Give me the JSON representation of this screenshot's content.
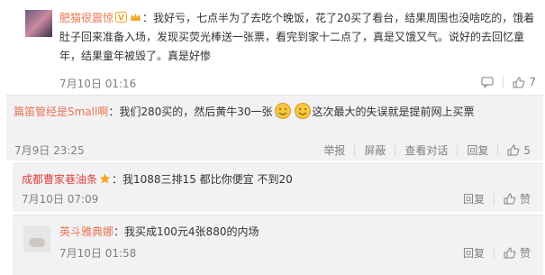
{
  "comments": [
    {
      "name": "肥猫很震惊",
      "text": "：我好亏，七点半为了去吃个晚饭，花了20买了看台，结果周围也没啥吃的，饿着肚子回来准备入场，发现买荧光棒送一张票，看完到家十二点了，真是又饿又气。说好的去回忆童年，结果童年被毁了。真是好惨",
      "time": "7月10日 01:16",
      "like_count": "7"
    },
    {
      "name": "篇笛管经是Small啊",
      "text_before": "：我们280买的，然后黄牛30一张",
      "text_after": "这次最大的失误就是提前网上买票",
      "time": "7月9日 23:25",
      "actions": [
        "举报",
        "屏蔽",
        "查看对话",
        "回复"
      ],
      "like_count": "5"
    },
    {
      "name": "成都曹家巷油条",
      "text": "：我1088三排15 都比你便宜 不到20",
      "time": "7月10日 07:09",
      "actions": [
        "回复",
        "赞"
      ]
    },
    {
      "name": "英斗雅典娜",
      "text": "：我买成100元4张880的内场",
      "time": "7月10日 01:58",
      "actions": [
        "回复",
        "赞"
      ]
    }
  ],
  "colors": {
    "name": "#eb7350",
    "name_highlight": "#e0403a",
    "meta": "#808080",
    "reply_bg": "#f2f2f5"
  }
}
